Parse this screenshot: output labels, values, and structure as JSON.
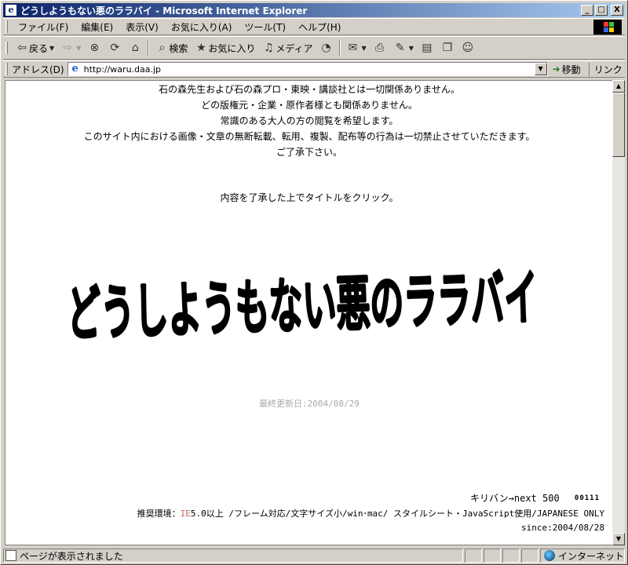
{
  "window": {
    "title": "どうしようもない悪のララバイ - Microsoft Internet Explorer",
    "minimize": "_",
    "maximize": "□",
    "close": "X"
  },
  "menu": {
    "items": [
      "ファイル(F)",
      "編集(E)",
      "表示(V)",
      "お気に入り(A)",
      "ツール(T)",
      "ヘルプ(H)"
    ]
  },
  "toolbar": {
    "back": "戻る",
    "search": "検索",
    "favorites": "お気に入り",
    "media": "メディア"
  },
  "address": {
    "label": "アドレス(D)",
    "url": "http://waru.daa.jp",
    "go": "移動",
    "links": "リンク"
  },
  "page": {
    "notice": [
      "石の森先生および石の森プロ・東映・講談社とは一切関係ありません。",
      "どの版権元・企業・原作者様とも関係ありません。",
      "常識のある大人の方の閲覧を希望します。",
      "このサイト内における画像・文章の無断転載、転用、複製、配布等の行為は一切禁止させていただきます。",
      "ご了承下さい。"
    ],
    "instruction": "内容を了承した上でタイトルをクリック。",
    "logo_text": "どうしようもない悪のララバイ",
    "last_updated": "最終更新日:2004/08/29",
    "kiriban": "キリバン→next 500",
    "counter": "00111",
    "env_prefix": "推奨環境：",
    "env_ie": "IE",
    "env_rest": "5.0以上 /フレーム対応/文字サイズ小/win･mac/ スタイルシート・JavaScript使用/JAPANESE ONLY",
    "since": "since:2004/08/28"
  },
  "status": {
    "message": "ページが表示されました",
    "zone": "インターネット"
  }
}
